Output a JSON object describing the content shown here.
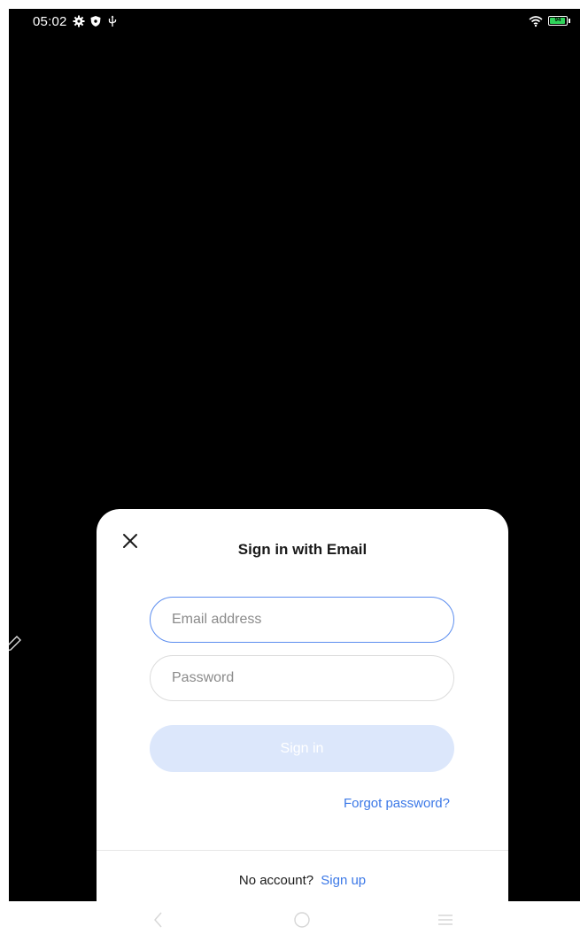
{
  "status_bar": {
    "time": "05:02",
    "icons": [
      "settings-gear-icon",
      "shield-icon",
      "usb-icon",
      "wifi-icon",
      "battery-charging-icon"
    ],
    "battery_level": "94",
    "battery_color": "#2fd35a"
  },
  "dialog": {
    "title": "Sign in with Email",
    "email_placeholder": "Email address",
    "email_value": "",
    "password_placeholder": "Password",
    "password_value": "",
    "signin_label": "Sign in",
    "forgot_label": "Forgot password?",
    "no_account_text": "No account?",
    "signup_label": "Sign up"
  },
  "colors": {
    "accent": "#3b78e7",
    "focus_border": "#5b8def",
    "button_disabled_bg": "#dce7fb",
    "backdrop": "#000000"
  },
  "nav_bar": {
    "buttons": [
      "back-icon",
      "home-icon",
      "menu-icon"
    ]
  }
}
